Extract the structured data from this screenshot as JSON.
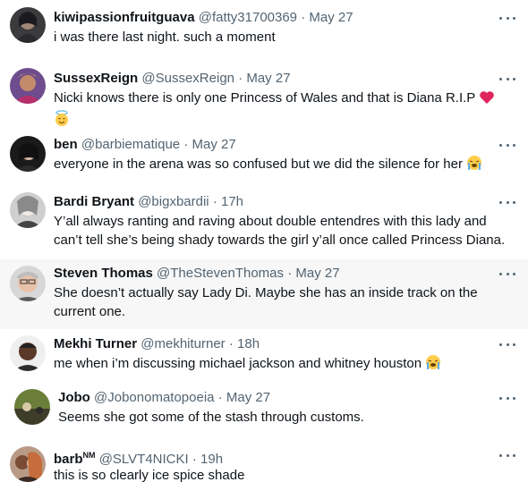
{
  "tweets": [
    {
      "name": "kiwipassionfruitguava",
      "handle": "@fatty31700369",
      "time": "May 27",
      "text": "i was there last night. such a moment"
    },
    {
      "name": "SussexReign",
      "handle": "@SussexReign",
      "time": "May 27",
      "text": "Nicki knows there is only one Princess of Wales and that is Diana R.I.P",
      "emoji": [
        "red-heart-icon",
        "smiling-face-with-halo-icon"
      ]
    },
    {
      "name": "ben",
      "handle": "@barbiematique",
      "time": "May 27",
      "text": "everyone in the arena was so confused but we did the silence for her",
      "emoji": [
        "loudly-crying-face-icon"
      ]
    },
    {
      "name": "Bardi Bryant",
      "handle": "@bigxbardii",
      "time": "17h",
      "text": "Y’all always ranting and raving about double entendres with this lady and can’t tell she’s being shady towards the girl y’all once called Princess Diana."
    },
    {
      "name": "Steven Thomas",
      "handle": "@TheStevenThomas",
      "time": "May 27",
      "text": "She doesn’t actually say Lady Di. Maybe she has an inside track on the current one."
    },
    {
      "name": "Mekhi Turner",
      "handle": "@mekhiturner",
      "time": "18h",
      "text": "me when i’m discussing michael jackson and whitney houston",
      "emoji": [
        "loudly-crying-face-icon"
      ]
    },
    {
      "name": "Jobo",
      "handle": "@Jobonomatopoeia",
      "time": "May 27",
      "text": "Seems she got some of the stash through customs."
    },
    {
      "name": "barb",
      "name_sup": "NM",
      "handle": "@SLVT4NICKI",
      "time": "19h",
      "text": "this is so clearly ice spice shade"
    }
  ],
  "separator": "·",
  "colors": {
    "text": "#0f1419",
    "secondary": "#536471",
    "highlight_bg": "#f7f7f7"
  }
}
